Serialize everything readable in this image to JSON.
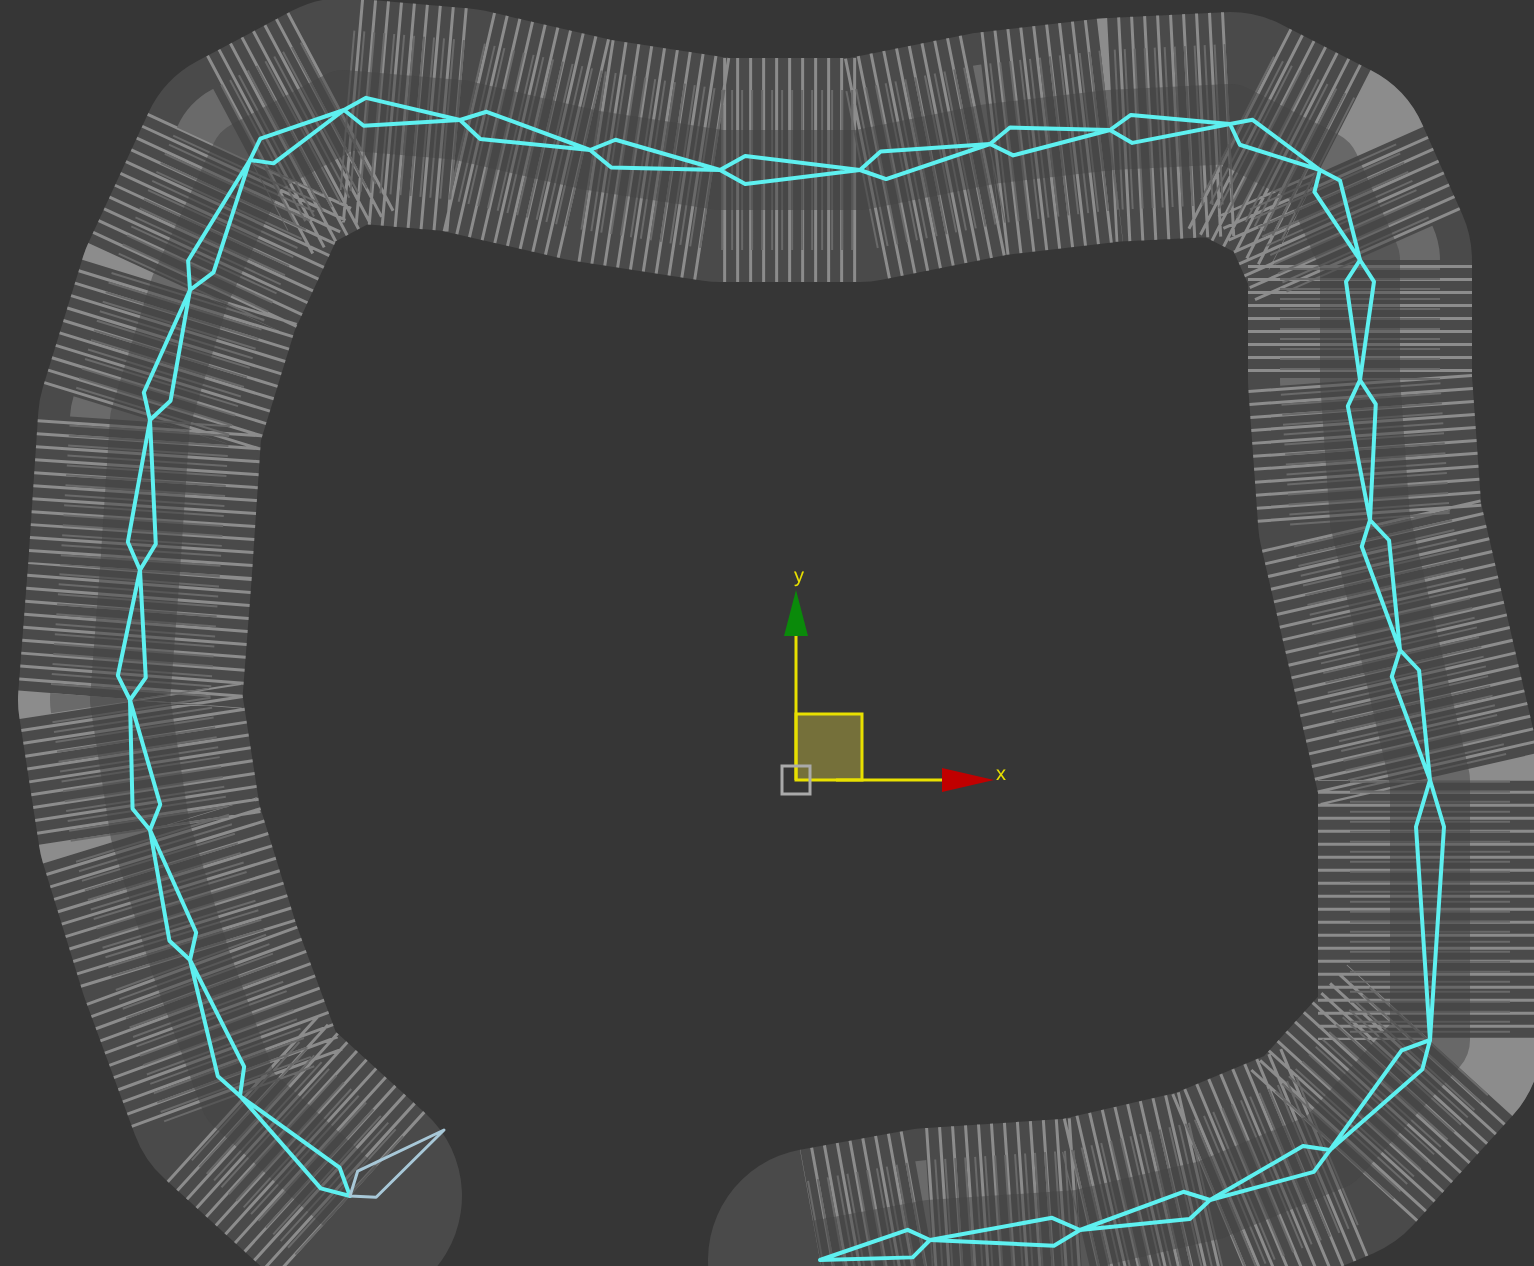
{
  "viewport": {
    "gizmo": {
      "y_label": "y",
      "x_label": "x"
    }
  }
}
